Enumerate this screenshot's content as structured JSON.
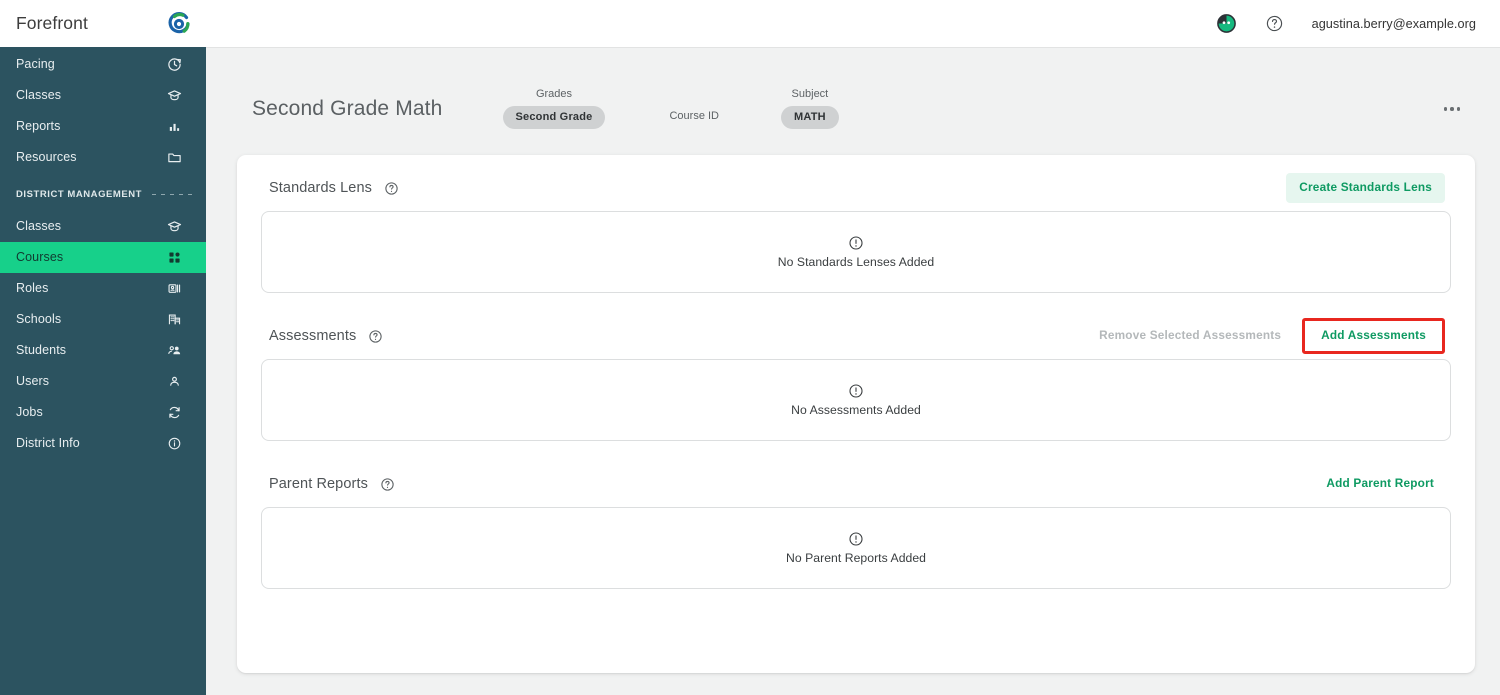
{
  "brand": {
    "name": "Forefront",
    "logo_icon": "forefront-logo-icon"
  },
  "sidebar": {
    "primary_items": [
      {
        "label": "Pacing",
        "icon": "clock-history-icon"
      },
      {
        "label": "Classes",
        "icon": "graduation-cap-icon"
      },
      {
        "label": "Reports",
        "icon": "bar-chart-icon"
      },
      {
        "label": "Resources",
        "icon": "folder-icon"
      }
    ],
    "section_label": "DISTRICT MANAGEMENT",
    "district_items": [
      {
        "label": "Classes",
        "icon": "graduation-cap-icon",
        "active": false
      },
      {
        "label": "Courses",
        "icon": "grid-apps-icon",
        "active": true
      },
      {
        "label": "Roles",
        "icon": "id-badge-icon",
        "active": false
      },
      {
        "label": "Schools",
        "icon": "building-icon",
        "active": false
      },
      {
        "label": "Students",
        "icon": "people-icon",
        "active": false
      },
      {
        "label": "Users",
        "icon": "person-icon",
        "active": false
      },
      {
        "label": "Jobs",
        "icon": "sync-icon",
        "active": false
      },
      {
        "label": "District Info",
        "icon": "info-circle-icon",
        "active": false
      }
    ],
    "active_color": "#17d08a",
    "background_color": "#2c5360"
  },
  "topbar": {
    "avatar_icon": "user-avatar-icon",
    "help_icon": "question-circle-icon",
    "email": "agustina.berry@example.org"
  },
  "course": {
    "title": "Second Grade Math",
    "grades_label": "Grades",
    "grades_value": "Second Grade",
    "course_id_label": "Course ID",
    "course_id_value": "",
    "subject_label": "Subject",
    "subject_value": "MATH",
    "more_menu_icon": "kebab-menu-icon"
  },
  "sections": {
    "standards_lens": {
      "title": "Standards Lens",
      "help_icon": "question-circle-icon",
      "action_label": "Create Standards Lens",
      "empty_icon": "exclamation-circle-icon",
      "empty_text": "No Standards Lenses Added"
    },
    "assessments": {
      "title": "Assessments",
      "help_icon": "question-circle-icon",
      "remove_label": "Remove Selected Assessments",
      "add_label": "Add Assessments",
      "add_highlight_color": "#e8271f",
      "empty_icon": "exclamation-circle-icon",
      "empty_text": "No Assessments Added"
    },
    "parent_reports": {
      "title": "Parent Reports",
      "help_icon": "question-circle-icon",
      "action_label": "Add Parent Report",
      "empty_icon": "exclamation-circle-icon",
      "empty_text": "No Parent Reports Added"
    }
  },
  "theme": {
    "accent_green": "#0e9a62",
    "soft_green_bg": "#e6f6ef",
    "page_bg": "#f1f2f2",
    "chip_bg": "#cfd1d2"
  }
}
